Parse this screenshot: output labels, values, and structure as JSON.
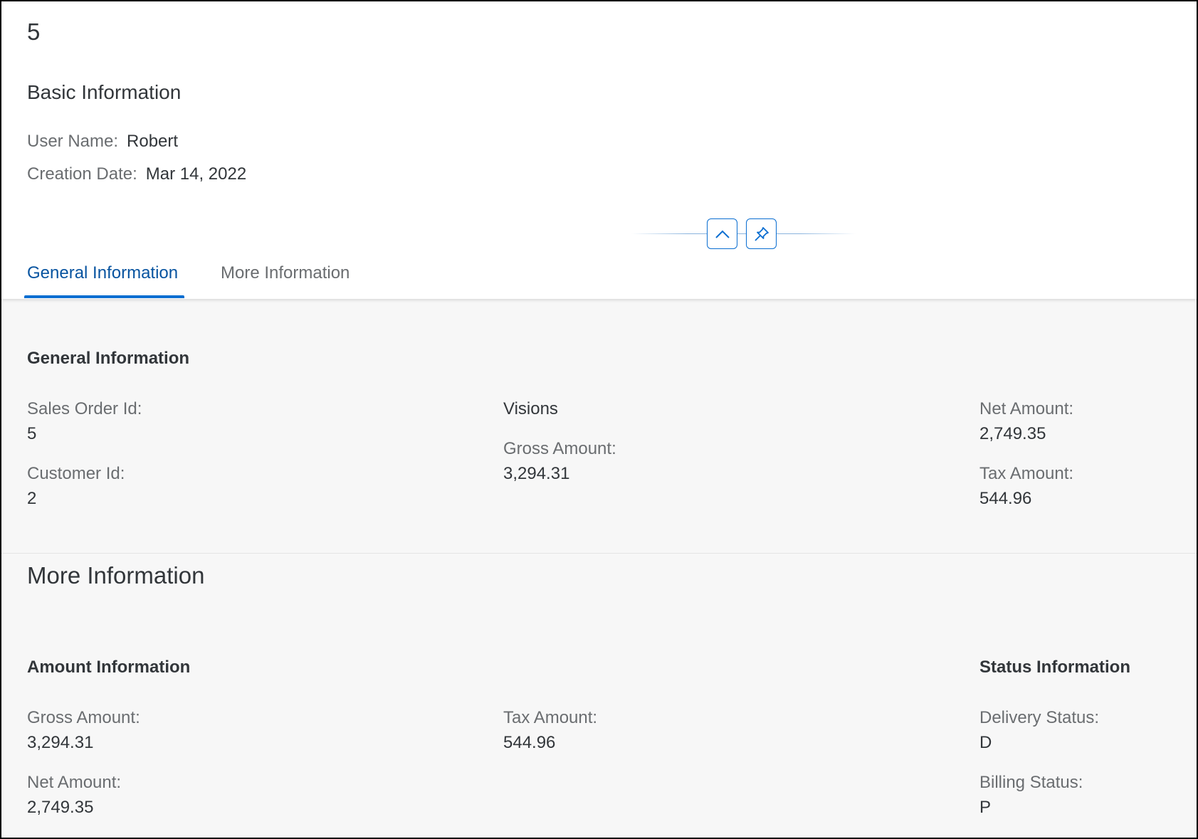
{
  "header": {
    "object_title": "5",
    "section_title": "Basic Information",
    "fields": [
      {
        "label": "User Name:",
        "value": "Robert"
      },
      {
        "label": "Creation Date:",
        "value": "Mar 14, 2022"
      }
    ],
    "collapse_icon": "chevron-up-icon",
    "pin_icon": "pin-icon"
  },
  "tabs": [
    {
      "label": "General Information",
      "active": true
    },
    {
      "label": "More Information",
      "active": false
    }
  ],
  "general": {
    "title": "General Information",
    "sales_order_id": {
      "label": "Sales Order Id:",
      "value": "5"
    },
    "customer_id": {
      "label": "Customer Id:",
      "value": "2"
    },
    "group_title": "Visions",
    "gross_amount": {
      "label": "Gross Amount:",
      "value": "3,294.31"
    },
    "net_amount": {
      "label": "Net Amount:",
      "value": "2,749.35"
    },
    "tax_amount": {
      "label": "Tax Amount:",
      "value": "544.96"
    }
  },
  "more": {
    "title": "More Information",
    "amount": {
      "title": "Amount Information",
      "gross_amount": {
        "label": "Gross Amount:",
        "value": "3,294.31"
      },
      "net_amount": {
        "label": "Net Amount:",
        "value": "2,749.35"
      },
      "tax_amount": {
        "label": "Tax Amount:",
        "value": "544.96"
      }
    },
    "status": {
      "title": "Status Information",
      "delivery_status": {
        "label": "Delivery Status:",
        "value": "D"
      },
      "billing_status": {
        "label": "Billing Status:",
        "value": "P"
      }
    }
  },
  "colors": {
    "accent": "#0a6ed1",
    "active_tab": "#0854a0",
    "label": "#6a6d70",
    "text": "#32363a",
    "background": "#f7f7f7"
  }
}
